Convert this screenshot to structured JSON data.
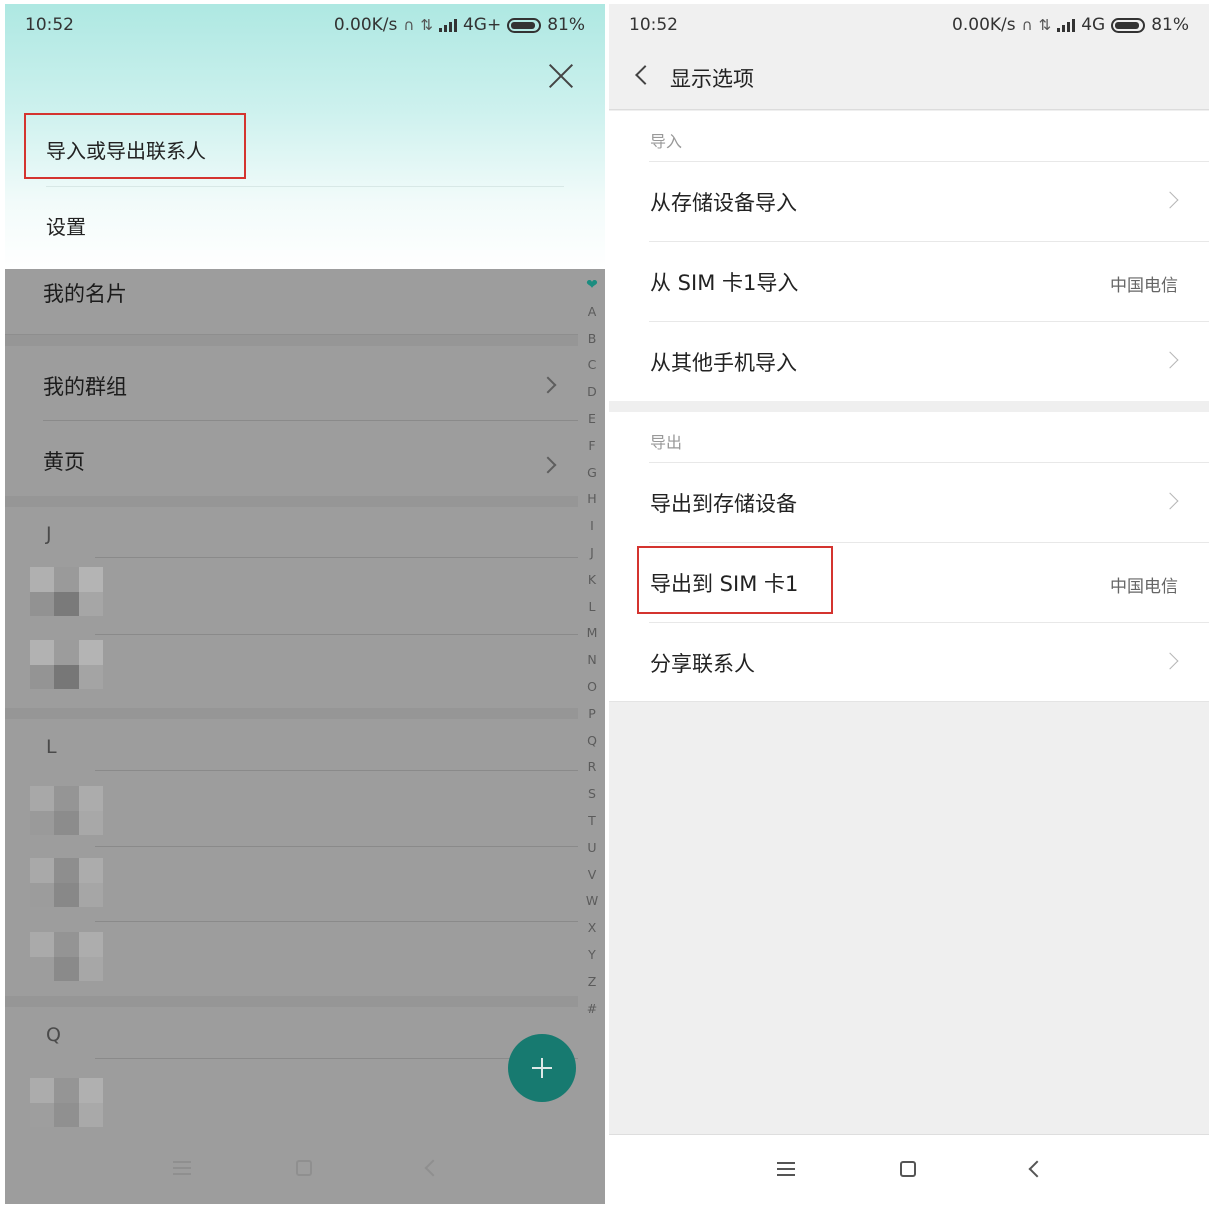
{
  "left": {
    "status": {
      "time": "10:52",
      "speed": "0.00K/s",
      "network": "4G+",
      "battery": "81%"
    },
    "menu": {
      "import_export": "导入或导出联系人",
      "settings": "设置"
    },
    "list": {
      "my_card": "我的名片",
      "my_groups": "我的群组",
      "yellow_pages": "黄页"
    },
    "sections": [
      "J",
      "L",
      "Q"
    ],
    "index_letters": [
      "A",
      "B",
      "C",
      "D",
      "E",
      "F",
      "G",
      "H",
      "I",
      "J",
      "K",
      "L",
      "M",
      "N",
      "O",
      "P",
      "Q",
      "R",
      "S",
      "T",
      "U",
      "V",
      "W",
      "X",
      "Y",
      "Z",
      "#"
    ],
    "index_top_icon": "heart-icon",
    "fab_icon": "plus-icon",
    "accent_color": "#177a70",
    "highlight_color": "#d4342f"
  },
  "right": {
    "status": {
      "time": "10:52",
      "speed": "0.00K/s",
      "network": "4G",
      "battery": "81%"
    },
    "title": "显示选项",
    "import": {
      "label": "导入",
      "rows": [
        {
          "text": "从存储设备导入",
          "value": ""
        },
        {
          "text": "从 SIM 卡1导入",
          "value": "中国电信"
        },
        {
          "text": "从其他手机导入",
          "value": ""
        }
      ]
    },
    "export": {
      "label": "导出",
      "rows": [
        {
          "text": "导出到存储设备",
          "value": ""
        },
        {
          "text": "导出到 SIM 卡1",
          "value": "中国电信"
        },
        {
          "text": "分享联系人",
          "value": ""
        }
      ]
    }
  }
}
